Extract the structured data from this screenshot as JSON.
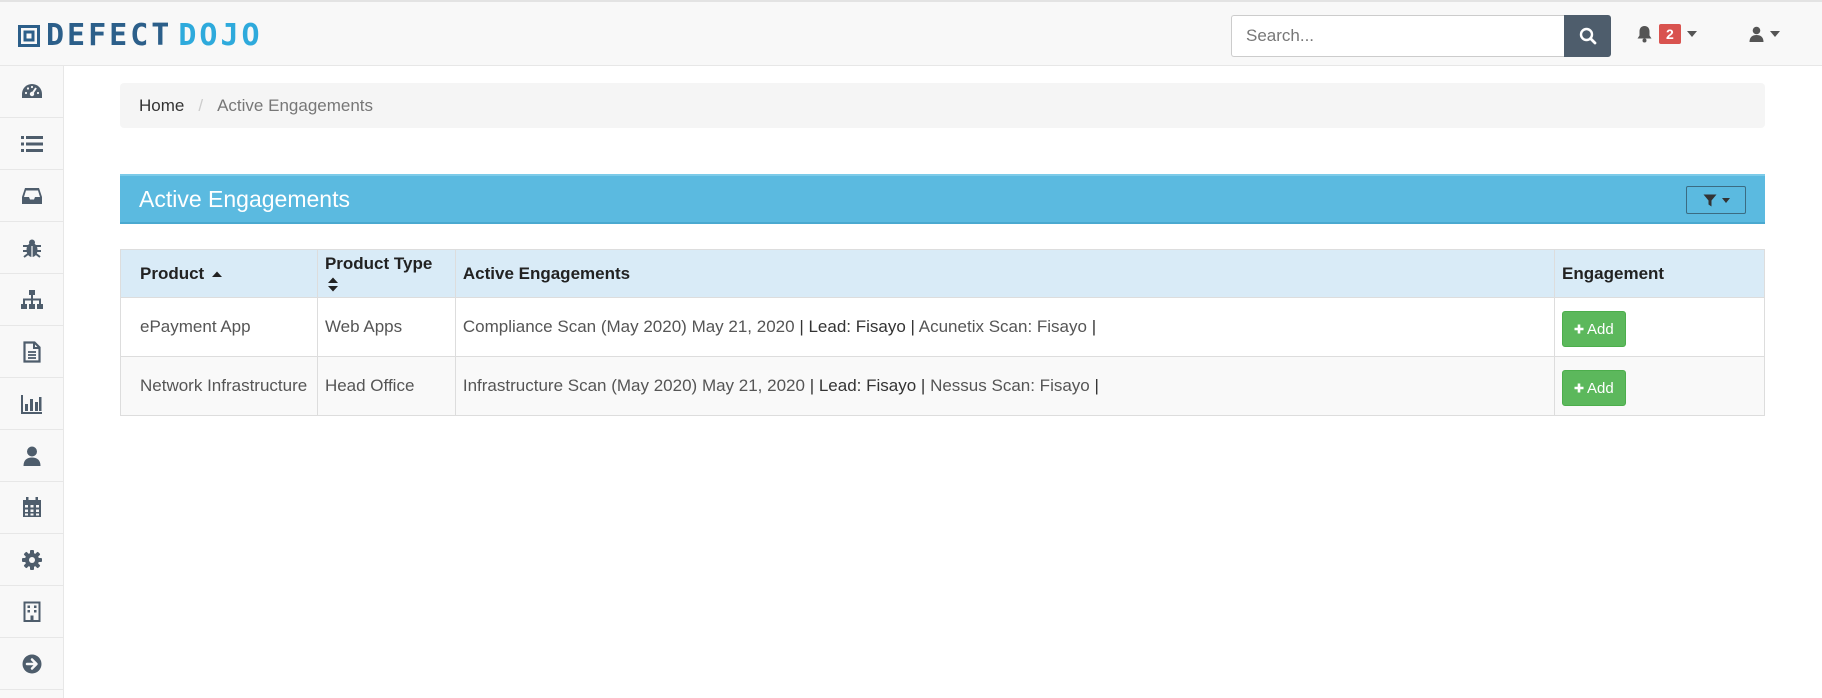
{
  "header": {
    "logo_part1": "DEFECT",
    "logo_part2": "DOJO",
    "search_placeholder": "Search...",
    "notification_count": "2"
  },
  "sidebar": {
    "icons": [
      "dashboard-icon",
      "list-icon",
      "inbox-icon",
      "bug-icon",
      "sitemap-icon",
      "file-icon",
      "bar-chart-icon",
      "user-icon",
      "calendar-icon",
      "gear-icon",
      "building-icon",
      "arrow-circle-right-icon"
    ]
  },
  "breadcrumb": {
    "home": "Home",
    "separator": "/",
    "current": "Active Engagements"
  },
  "panel": {
    "title": "Active Engagements"
  },
  "table": {
    "headers": [
      "Product",
      "Product Type",
      "Active Engagements",
      "Engagement"
    ],
    "rows": [
      {
        "product": "ePayment App",
        "product_type": "Web Apps",
        "engagement_name": "Compliance Scan (May 2020)",
        "date": "May 21, 2020",
        "sep1": "|",
        "lead": "Lead: Fisayo",
        "sep2": "|",
        "scan": "Acunetix Scan: Fisayo",
        "sep3": "|",
        "add_label": "Add"
      },
      {
        "product": "Network Infrastructure",
        "product_type": "Head Office",
        "engagement_name": "Infrastructure Scan (May 2020)",
        "date": "May 21, 2020",
        "sep1": "|",
        "lead": "Lead: Fisayo",
        "sep2": "|",
        "scan": "Nessus Scan: Fisayo",
        "sep3": "|",
        "add_label": "Add"
      }
    ]
  },
  "colors": {
    "panel_header": "#5bbae0",
    "table_header": "#d9ebf7",
    "add_button": "#5cb85c",
    "badge": "#d9534f",
    "logo_dark": "#2c5f8a",
    "logo_light": "#2eaadc"
  }
}
